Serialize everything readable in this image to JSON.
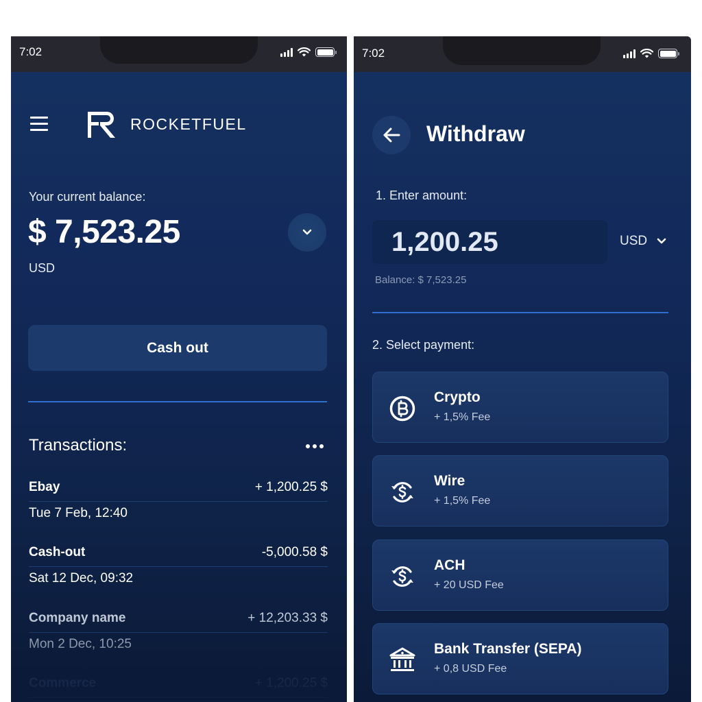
{
  "status_bar": {
    "left_time": "7:02",
    "right_time": "7:02"
  },
  "home": {
    "brand": "ROCKETFUEL",
    "balance_label": "Your current balance:",
    "balance_amount": "$ 7,523.25",
    "balance_currency": "USD",
    "cashout_label": "Cash out",
    "transactions_title": "Transactions:",
    "transactions": [
      {
        "name": "Ebay",
        "amount": "+ 1,200.25 $",
        "date": "Tue 7 Feb, 12:40"
      },
      {
        "name": "Cash-out",
        "amount": "-5,000.58 $",
        "date": "Sat 12 Dec, 09:32"
      },
      {
        "name": "Company name",
        "amount": "+ 12,203.33 $",
        "date": "Mon 2 Dec, 10:25"
      },
      {
        "name": "Commerce",
        "amount": "+ 1,200.25 $",
        "date": ""
      }
    ]
  },
  "withdraw": {
    "title": "Withdraw",
    "step1_label": "1. Enter amount:",
    "amount_value": "1,200.25",
    "currency": "USD",
    "balance_note": "Balance:  $ 7,523.25",
    "step2_label": "2. Select payment:",
    "payment_methods": [
      {
        "name": "Crypto",
        "fee": "+ 1,5% Fee",
        "icon": "bitcoin-icon"
      },
      {
        "name": "Wire",
        "fee": "+ 1,5% Fee",
        "icon": "dollar-exchange-icon"
      },
      {
        "name": "ACH",
        "fee": "+ 20 USD Fee",
        "icon": "dollar-exchange-icon"
      },
      {
        "name": "Bank Transfer (SEPA)",
        "fee": "+ 0,8 USD Fee",
        "icon": "bank-icon"
      }
    ]
  },
  "colors": {
    "background_top": "#153261",
    "background_bottom": "#0b1a38",
    "accent_divider": "#2f6fd0",
    "button_bg": "#1c3a6b",
    "status_bar": "#272730"
  }
}
